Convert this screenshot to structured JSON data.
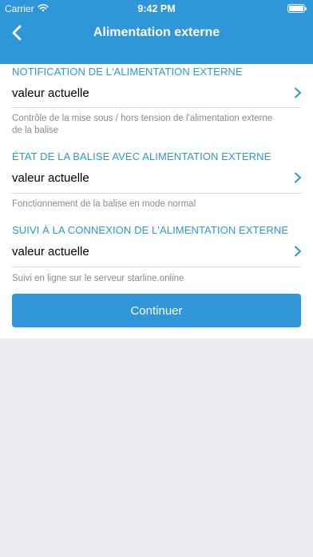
{
  "status_bar": {
    "carrier": "Carrier",
    "time": "9:42 PM",
    "wifi_icon": "wifi-icon",
    "battery_icon": "battery-icon"
  },
  "nav": {
    "title": "Alimentation externe",
    "back_icon": "chevron-left-icon"
  },
  "sections": [
    {
      "title": "NOTIFICATION DE L'ALIMENTATION EXTERNE",
      "value": "valeur actuelle",
      "description": "Contrôle de la mise sous / hors tension de l'alimentation externe de la balise"
    },
    {
      "title": "ÉTAT DE LA BALISE AVEC ALIMENTATION EXTERNE",
      "value": "valeur actuelle",
      "description": "Fonctionnement de la balise en mode normal"
    },
    {
      "title": "SUIVI À LA CONNEXION DE L'ALIMENTATION EXTERNE",
      "value": "valeur actuelle",
      "description": "Suivi en ligne sur le serveur starline.online"
    }
  ],
  "continue_label": "Continuer",
  "colors": {
    "accent": "#2e96d9",
    "background": "#ebebf0",
    "description_text": "#8a8a8f"
  }
}
